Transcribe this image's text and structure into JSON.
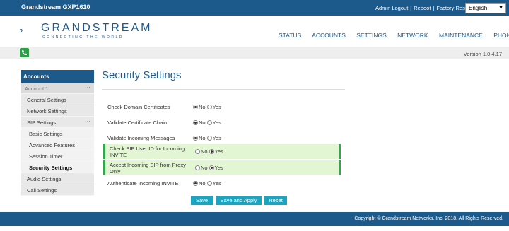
{
  "topbar": {
    "model": "Grandstream GXP1610",
    "links": [
      "Admin Logout",
      "Reboot",
      "Factory Reset"
    ],
    "separator": "|",
    "language": "English"
  },
  "header": {
    "brand": "GRANDSTREAM",
    "tagline": "CONNECTING THE WORLD",
    "nav": [
      "STATUS",
      "ACCOUNTS",
      "SETTINGS",
      "NETWORK",
      "MAINTENANCE",
      "PHONEBOOK"
    ]
  },
  "status_strip": {
    "version": "Version 1.0.4.17",
    "phone_icon": "phone-icon",
    "accent": "#2e9e49"
  },
  "sidebar": {
    "header": "Accounts",
    "items": [
      {
        "label": "Account 1",
        "kind": "group",
        "collapse": "⋯"
      },
      {
        "label": "General Settings",
        "kind": "item"
      },
      {
        "label": "Network Settings",
        "kind": "item"
      },
      {
        "label": "SIP Settings",
        "kind": "group2",
        "collapse": "⋯"
      },
      {
        "label": "Basic Settings",
        "kind": "sub"
      },
      {
        "label": "Advanced Features",
        "kind": "sub"
      },
      {
        "label": "Session Timer",
        "kind": "sub"
      },
      {
        "label": "Security Settings",
        "kind": "sub",
        "active": true
      },
      {
        "label": "Audio Settings",
        "kind": "item"
      },
      {
        "label": "Call Settings",
        "kind": "item"
      }
    ]
  },
  "main": {
    "title": "Security Settings",
    "option_no": "No",
    "option_yes": "Yes",
    "settings": [
      {
        "label": "Check Domain Certificates",
        "value": "No",
        "highlight": false
      },
      {
        "label": "Validate Certificate Chain",
        "value": "No",
        "highlight": false
      },
      {
        "label": "Validate Incoming Messages",
        "value": "No",
        "highlight": false
      },
      {
        "label": "Check SIP User ID for Incoming INVITE",
        "value": "Yes",
        "highlight": true
      },
      {
        "label": "Accept Incoming SIP from Proxy Only",
        "value": "Yes",
        "highlight": true
      },
      {
        "label": "Authenticate Incoming INVITE",
        "value": "No",
        "highlight": false
      }
    ],
    "buttons": {
      "save": "Save",
      "save_apply": "Save and Apply",
      "reset": "Reset"
    }
  },
  "footer": {
    "copyright": "Copyright © Grandstream Networks, Inc. 2018. All Rights Reserved."
  },
  "colors": {
    "primary": "#1d5a8c",
    "button": "#1aa6c1",
    "highlight_bg": "#e3f6d4",
    "highlight_border": "#2fa84a"
  }
}
